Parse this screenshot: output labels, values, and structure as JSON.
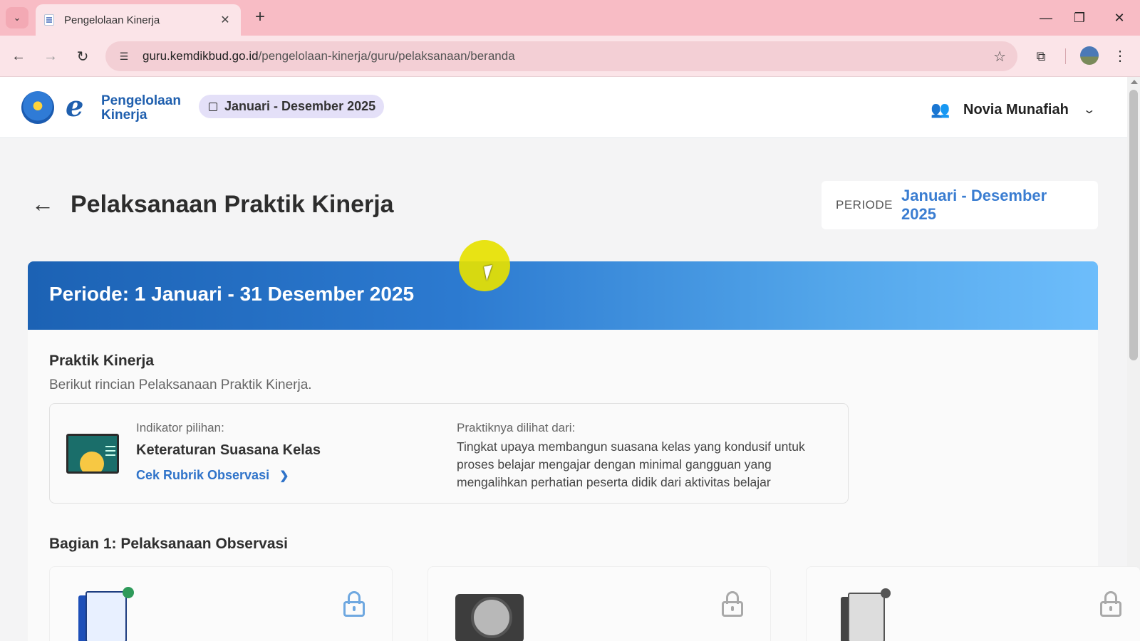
{
  "browser": {
    "tab_title": "Pengelolaan Kinerja",
    "tab_close": "✕",
    "new_tab": "+",
    "url_domain": "guru.kemdikbud.go.id",
    "url_path": "/pengelolaan-kinerja/guru/pelaksanaan/beranda",
    "window_controls": {
      "minimize": "—",
      "restore": "❐",
      "close": "✕"
    }
  },
  "header": {
    "logo_mark": "e",
    "logo_line1": "Pengelolaan",
    "logo_line2": "Kinerja",
    "period_pill": "Januari - Desember 2025",
    "user_name": "Novia Munafiah"
  },
  "page": {
    "title": "Pelaksanaan Praktik Kinerja",
    "periode_label": "PERIODE",
    "periode_value": "Januari - Desember 2025",
    "banner": "Periode: 1 Januari - 31 Desember 2025",
    "section_title": "Praktik Kinerja",
    "section_subtitle": "Berikut rincian Pelaksanaan Praktik Kinerja.",
    "indicator": {
      "label": "Indikator pilihan:",
      "title": "Keteraturan Suasana Kelas",
      "link": "Cek Rubrik Observasi",
      "practice_label": "Praktiknya dilihat dari:",
      "practice_desc": "Tingkat upaya membangun suasana kelas yang kondusif untuk proses belajar mengajar dengan minimal gangguan yang mengalihkan perhatian peserta didik dari aktivitas belajar"
    },
    "section2_title": "Bagian 1: Pelaksanaan Observasi"
  },
  "colors": {
    "accent": "#3a7dd1",
    "banner_start": "#1c62b4",
    "banner_end": "#6dbdfb",
    "tabbar": "#f8bcc5",
    "lock_active": "#6fa8e0",
    "lock_inactive": "#a9a9a9"
  },
  "icons": [
    "back-arrow-icon",
    "forward-arrow-icon",
    "reload-icon",
    "site-settings-icon",
    "bookmark-star-icon",
    "extensions-icon",
    "more-menu-icon",
    "calendar-icon",
    "people-icon",
    "chevron-down-icon",
    "chevron-right-icon",
    "lock-icon"
  ]
}
